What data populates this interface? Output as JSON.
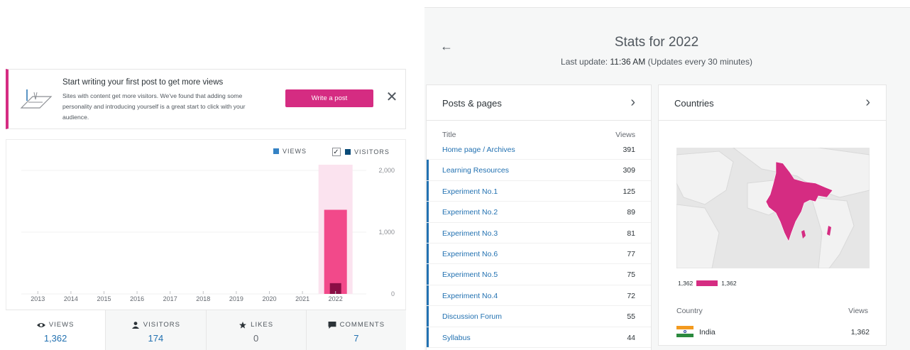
{
  "notice": {
    "title": "Start writing your first post to get more views",
    "body": "Sites with content get more visitors. We've found that adding some personality and introducing yourself is a great start to click with your audience.",
    "button_label": "Write a post",
    "close_glyph": "✕"
  },
  "legend": {
    "views_label": "VIEWS",
    "visitors_label": "VISITORS",
    "visitors_checked_glyph": "✓",
    "views_color": "#3582c4",
    "visitors_color": "#0a4b78"
  },
  "chart_data": {
    "type": "bar",
    "categories": [
      "2013",
      "2014",
      "2015",
      "2016",
      "2017",
      "2018",
      "2019",
      "2020",
      "2021",
      "2022"
    ],
    "series": [
      {
        "name": "VIEWS",
        "values": [
          0,
          0,
          0,
          0,
          0,
          0,
          0,
          0,
          0,
          1362
        ]
      },
      {
        "name": "VISITORS",
        "values": [
          0,
          0,
          0,
          0,
          0,
          0,
          0,
          0,
          0,
          174
        ]
      }
    ],
    "yticks": [
      "2,000",
      "1,000",
      "0"
    ],
    "ylim": [
      0,
      2000
    ],
    "selected_category": "2022",
    "grid": true
  },
  "tabs": [
    {
      "label": "VIEWS",
      "value": "1,362",
      "icon": "eye-icon"
    },
    {
      "label": "VISITORS",
      "value": "174",
      "icon": "person-icon"
    },
    {
      "label": "LIKES",
      "value": "0",
      "icon": "star-icon"
    },
    {
      "label": "COMMENTS",
      "value": "7",
      "icon": "comment-icon"
    }
  ],
  "header": {
    "back_glyph": "←",
    "title": "Stats for 2022",
    "last_update_prefix": "Last update: ",
    "last_update_time": "11:36 AM",
    "last_update_suffix": " (Updates every 30 minutes)"
  },
  "posts": {
    "title": "Posts & pages",
    "chevron": "›",
    "col_title": "Title",
    "col_views": "Views",
    "rows": [
      {
        "title": "Home page / Archives",
        "views": "391",
        "bar": false
      },
      {
        "title": "Learning Resources",
        "views": "309",
        "bar": true
      },
      {
        "title": "Experiment No.1",
        "views": "125",
        "bar": true
      },
      {
        "title": "Experiment No.2",
        "views": "89",
        "bar": true
      },
      {
        "title": "Experiment No.3",
        "views": "81",
        "bar": true
      },
      {
        "title": "Experiment No.6",
        "views": "77",
        "bar": true
      },
      {
        "title": "Experiment No.5",
        "views": "75",
        "bar": true
      },
      {
        "title": "Experiment No.4",
        "views": "72",
        "bar": true
      },
      {
        "title": "Discussion Forum",
        "views": "55",
        "bar": true
      },
      {
        "title": "Syllabus",
        "views": "44",
        "bar": true
      }
    ]
  },
  "countries": {
    "title": "Countries",
    "chevron": "›",
    "legend_min": "1,362",
    "legend_max": "1,362",
    "col_country": "Country",
    "col_views": "Views",
    "rows": [
      {
        "name": "India",
        "views": "1,362"
      }
    ],
    "highlight_color": "#d52c82"
  }
}
